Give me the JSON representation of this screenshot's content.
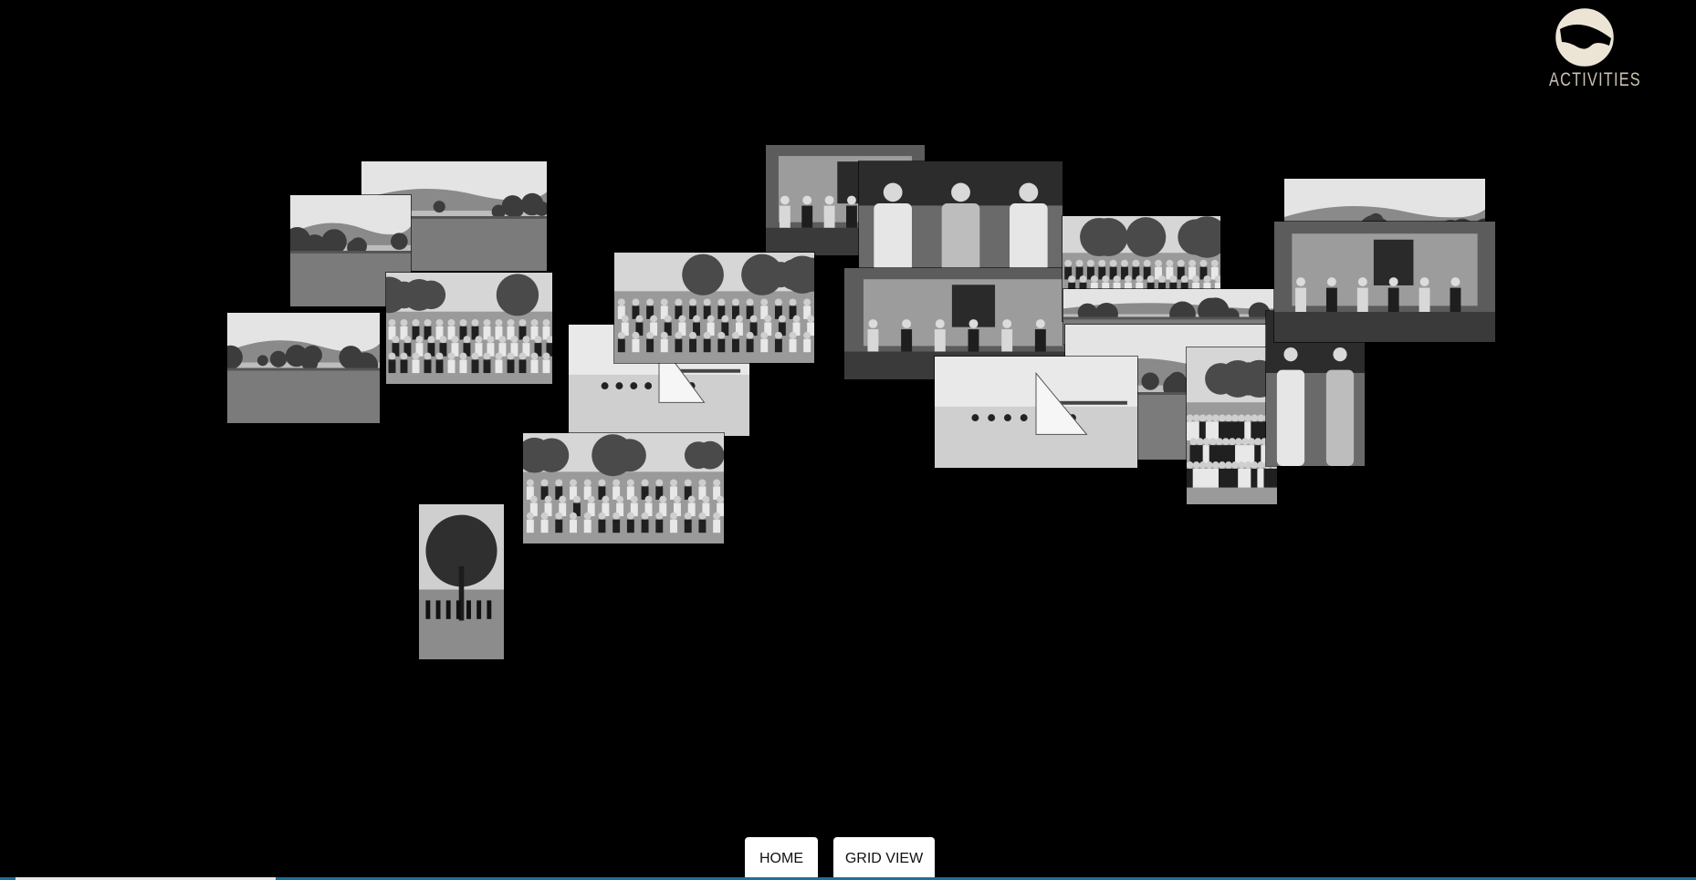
{
  "brand": {
    "logo_icon": "activities-badge-icon",
    "label": "ACTIVITIES",
    "badge_color": "#ece5d6",
    "text_color": "#c9c2b3"
  },
  "navigation": {
    "home_label": "HOME",
    "grid_label": "GRID VIEW"
  },
  "progress": {
    "fraction": 0.155,
    "track_color": "#1f6f99",
    "fill_color": "#e8e8e8"
  },
  "gallery": {
    "photos": [
      {
        "name": "photo-hillside-village",
        "scene": "landscape"
      },
      {
        "name": "photo-lakeshore-flagpole",
        "scene": "landscape"
      },
      {
        "name": "photo-lake-field",
        "scene": "landscape"
      },
      {
        "name": "photo-uniformed-group",
        "scene": "crowd"
      },
      {
        "name": "photo-cabin-interior",
        "scene": "interior"
      },
      {
        "name": "photo-swimmers-dock",
        "scene": "water"
      },
      {
        "name": "photo-orchard-group",
        "scene": "crowd"
      },
      {
        "name": "photo-tree-portrait",
        "scene": "tree"
      },
      {
        "name": "photo-three-women",
        "scene": "portrait"
      },
      {
        "name": "photo-stage-performance",
        "scene": "interior"
      },
      {
        "name": "photo-tug-of-war",
        "scene": "crowd"
      },
      {
        "name": "photo-treeline-field",
        "scene": "landscape"
      },
      {
        "name": "photo-open-field",
        "scene": "landscape"
      },
      {
        "name": "photo-sailboat-shore",
        "scene": "water"
      },
      {
        "name": "photo-picnic-crowd",
        "scene": "crowd"
      },
      {
        "name": "photo-two-women-garden",
        "scene": "portrait"
      },
      {
        "name": "photo-vintage-car",
        "scene": "landscape"
      },
      {
        "name": "photo-dancer-stage",
        "scene": "interior"
      },
      {
        "name": "photo-band-gazebo",
        "scene": "crowd"
      }
    ]
  }
}
